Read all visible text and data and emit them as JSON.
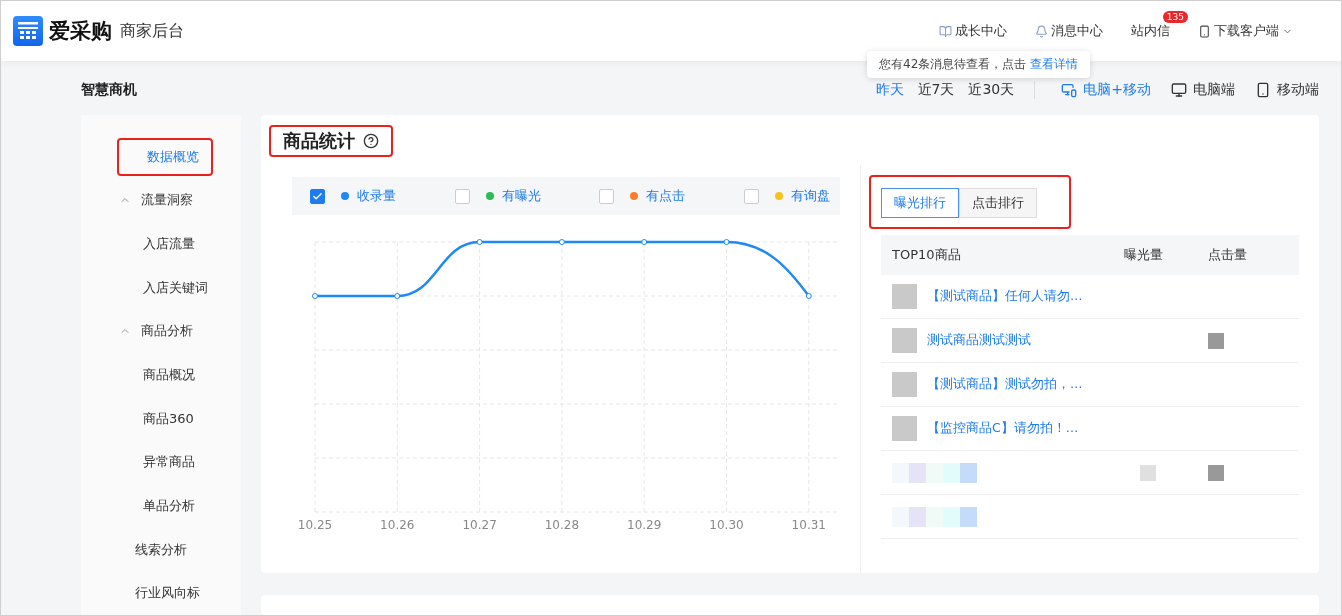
{
  "header": {
    "logo_text": "爱采购",
    "subtitle": "商家后台",
    "nav": [
      {
        "kind": "book",
        "label": "成长中心"
      },
      {
        "kind": "bell",
        "label": "消息中心"
      },
      {
        "kind": "mail",
        "label": "站内信",
        "badge": "135"
      },
      {
        "kind": "phone",
        "label": "下载客户端",
        "dropdown": true
      }
    ],
    "tooltip": {
      "text": "您有42条消息待查看，点击",
      "link": "查看详情"
    }
  },
  "page": {
    "title": "智慧商机",
    "ranges": [
      {
        "label": "昨天",
        "selected": true
      },
      {
        "label": "近7天",
        "selected": false
      },
      {
        "label": "近30天",
        "selected": false
      }
    ],
    "devices": [
      {
        "kind": "both",
        "label": "电脑+移动",
        "selected": true
      },
      {
        "kind": "pc",
        "label": "电脑端",
        "selected": false
      },
      {
        "kind": "mobile",
        "label": "移动端",
        "selected": false
      }
    ]
  },
  "sidebar": {
    "items": [
      {
        "label": "数据概览",
        "selected": true,
        "highlighted": true
      },
      {
        "label": "流量洞察",
        "selected": false,
        "expanded": true,
        "children": [
          {
            "label": "入店流量",
            "selected": false
          },
          {
            "label": "入店关键词",
            "selected": false
          }
        ]
      },
      {
        "label": "商品分析",
        "selected": false,
        "expanded": true,
        "children": [
          {
            "label": "商品概况",
            "selected": false
          },
          {
            "label": "商品360",
            "selected": false
          },
          {
            "label": "异常商品",
            "selected": false
          },
          {
            "label": "单品分析",
            "selected": false
          }
        ]
      },
      {
        "label": "线索分析",
        "selected": false
      },
      {
        "label": "行业风向标",
        "selected": false
      }
    ]
  },
  "stats": {
    "title": "商品统计",
    "highlighted": true,
    "legend": [
      {
        "label": "收录量",
        "color": "#1e88f5",
        "checked": true
      },
      {
        "label": "有曝光",
        "color": "#2dbb55",
        "checked": false
      },
      {
        "label": "有点击",
        "color": "#fa7d2d",
        "checked": false
      },
      {
        "label": "有询盘",
        "color": "#f7c21a",
        "checked": false
      }
    ],
    "x_labels": [
      "10.25",
      "10.26",
      "10.27",
      "10.28",
      "10.29",
      "10.30",
      "10.31"
    ],
    "rank_tabs": {
      "highlighted": true,
      "items": [
        {
          "label": "曝光排行",
          "selected": true
        },
        {
          "label": "点击排行",
          "selected": false
        }
      ]
    },
    "table": {
      "columns": [
        "TOP10商品",
        "曝光量",
        "点击量"
      ],
      "rows": [
        {
          "kind": "product",
          "name": "【测试商品】任何人请勿…",
          "exposure_masked": false,
          "click_masked": false
        },
        {
          "kind": "product",
          "name": "测试商品测试测试",
          "exposure_masked": false,
          "click_masked": true
        },
        {
          "kind": "product",
          "name": "【测试商品】测试勿拍，…",
          "exposure_masked": false,
          "click_masked": false
        },
        {
          "kind": "product",
          "name": "【监控商品C】请勿拍！…",
          "exposure_masked": false,
          "click_masked": false
        },
        {
          "kind": "blurred",
          "exposure_masked": true,
          "click_masked": true
        },
        {
          "kind": "blurred",
          "exposure_masked": false,
          "click_masked": false
        }
      ]
    }
  }
}
